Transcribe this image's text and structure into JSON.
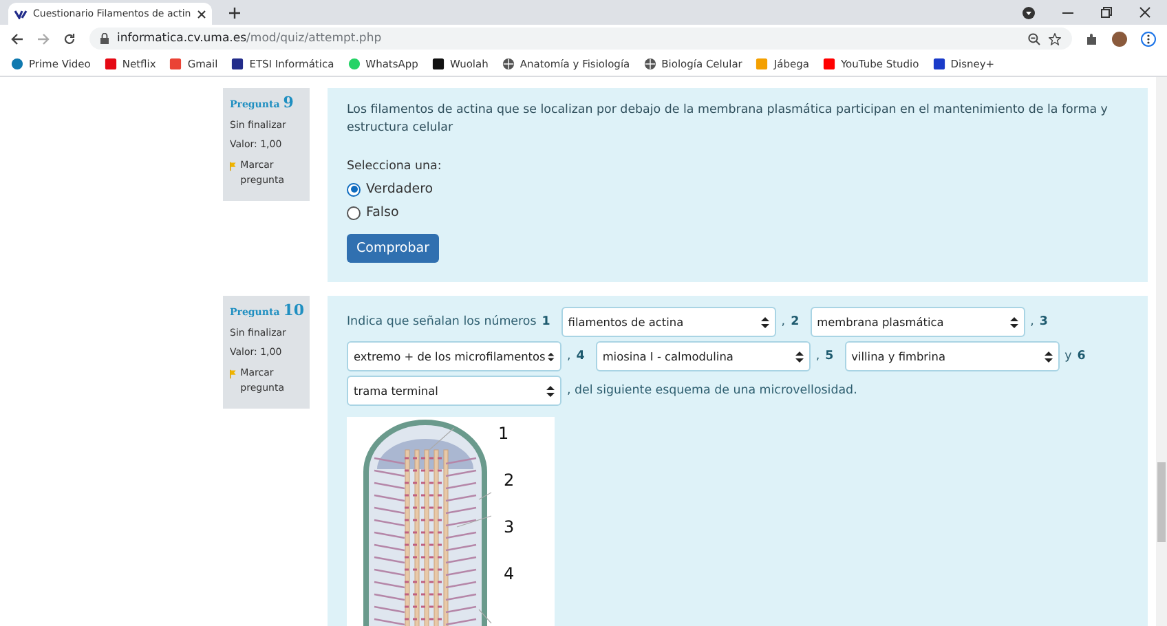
{
  "browser": {
    "tab_title": "Cuestionario Filamentos de actin",
    "url_host": "informatica.cv.uma.es",
    "url_path": "/mod/quiz/attempt.php",
    "bookmarks": [
      "Prime Video",
      "Netflix",
      "Gmail",
      "ETSI Informática",
      "WhatsApp",
      "Wuolah",
      "Anatomía y Fisiología",
      "Biología Celular",
      "Jábega",
      "YouTube Studio",
      "Disney+"
    ]
  },
  "questions": [
    {
      "label": "Pregunta",
      "number": "9",
      "status": "Sin finalizar",
      "value": "Valor: 1,00",
      "flag": "Marcar pregunta",
      "kind": "truefalse",
      "text": "Los filamentos de actina que se localizan por debajo de la membrana plasmática participan en el mantenimiento de la forma y estructura celular",
      "prompt": "Selecciona una:",
      "options": [
        {
          "label": "Verdadero",
          "selected": true
        },
        {
          "label": "Falso",
          "selected": false
        }
      ],
      "button": "Comprobar"
    },
    {
      "label": "Pregunta",
      "number": "10",
      "status": "Sin finalizar",
      "value": "Valor: 1,00",
      "flag": "Marcar pregunta",
      "kind": "dropdowns",
      "parts": [
        {
          "kind": "text",
          "text": "Indica que señalan los números"
        },
        {
          "kind": "number",
          "text": "1"
        },
        {
          "kind": "select",
          "value": "filamentos de actina"
        },
        {
          "kind": "text",
          "text": ","
        },
        {
          "kind": "number",
          "text": "2"
        },
        {
          "kind": "select",
          "value": "membrana plasmática"
        },
        {
          "kind": "text",
          "text": ","
        },
        {
          "kind": "number",
          "text": "3"
        },
        {
          "kind": "select",
          "value": "extremo + de los microfilamentos"
        },
        {
          "kind": "text",
          "text": ","
        },
        {
          "kind": "number",
          "text": "4"
        },
        {
          "kind": "select",
          "value": "miosina I - calmodulina"
        },
        {
          "kind": "text",
          "text": ","
        },
        {
          "kind": "number",
          "text": "5"
        },
        {
          "kind": "select",
          "value": "villina y fimbrina"
        },
        {
          "kind": "text",
          "text": "y"
        },
        {
          "kind": "number",
          "text": "6"
        },
        {
          "kind": "select",
          "value": "trama terminal"
        },
        {
          "kind": "text",
          "text": ",  del siguiente esquema de una microvellosidad."
        }
      ],
      "diagram_labels": [
        "1",
        "2",
        "3",
        "4"
      ]
    }
  ]
}
